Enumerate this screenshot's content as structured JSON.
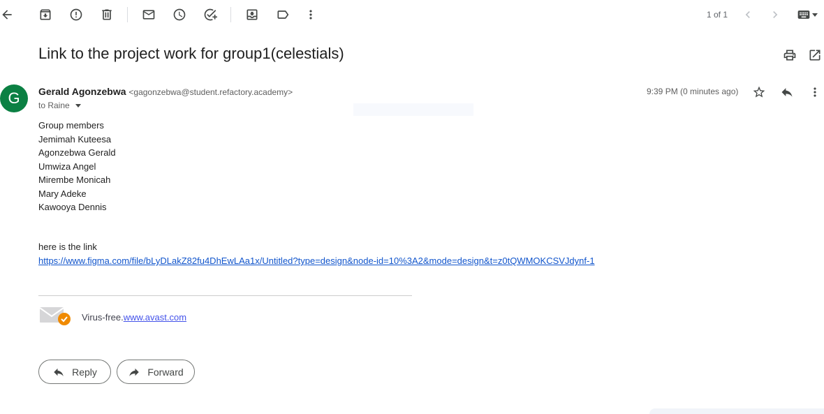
{
  "toolbar": {
    "icons": [
      "back-arrow-icon",
      "archive-icon",
      "report-spam-icon",
      "delete-icon",
      "mark-unread-icon",
      "snooze-icon",
      "add-to-tasks-icon",
      "move-to-icon",
      "label-icon",
      "more-vert-icon"
    ],
    "pager": "1 of 1",
    "nav_icons": [
      "chevron-left-icon",
      "chevron-right-icon",
      "keyboard-icon"
    ]
  },
  "email": {
    "subject": "Link to the project work for group1(celestials)",
    "avatar_letter": "G",
    "avatar_color": "#0b8043",
    "sender_name": "Gerald Agonzebwa",
    "sender_email": "<gagonzebwa@student.refactory.academy>",
    "to": "to Raine",
    "time": "9:39 PM (0 minutes ago)",
    "body_lines": [
      "Group members",
      "Jemimah Kuteesa",
      "Agonzebwa Gerald",
      "Umwiza Angel",
      "Mirembe Monicah",
      "Mary Adeke",
      "Kawooya Dennis"
    ],
    "link_intro": "here is the link",
    "link": "https://www.figma.com/file/bLyDLakZ82fu4DhEwLAa1x/Untitled?type=design&node-id=10%3A2&mode=design&t=z0tQWMOKCSVJdynf-1",
    "signature_prefix": "Virus-free.",
    "signature_link": "www.avast.com"
  },
  "actions": {
    "reply": "Reply",
    "forward": "Forward"
  },
  "colors": {
    "link": "#1155cc",
    "avast_badge": "#f08a00"
  }
}
